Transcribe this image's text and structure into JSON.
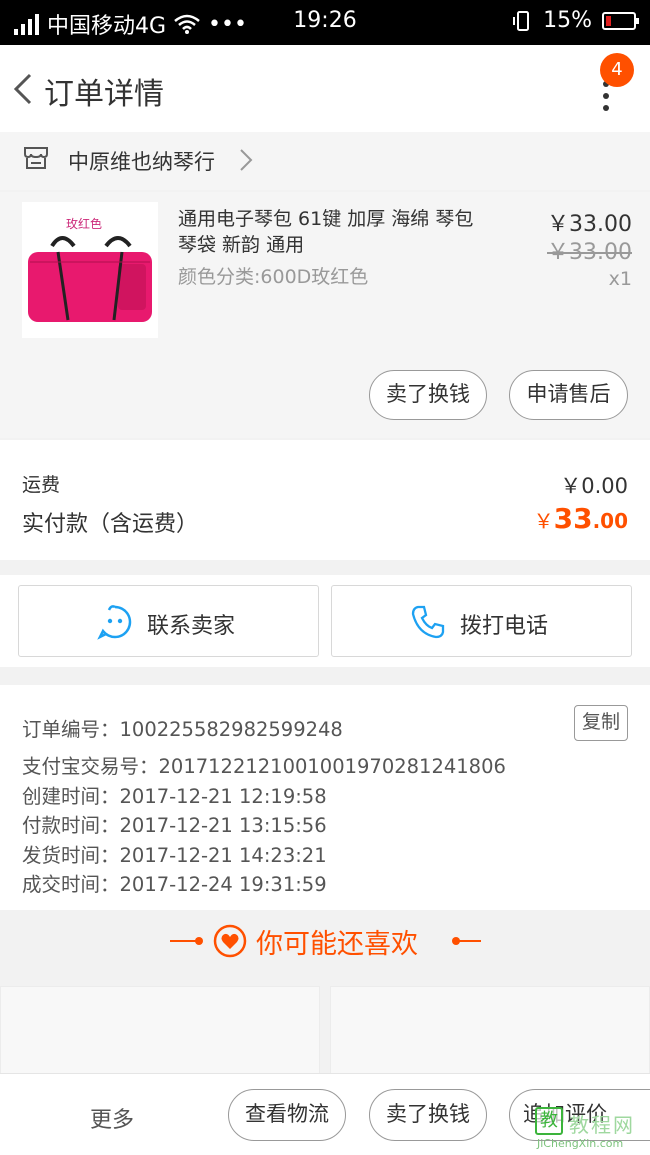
{
  "status_bar": {
    "carrier": "中国移动4G",
    "dots": "•••",
    "time": "19:26",
    "battery": "15%"
  },
  "header": {
    "title": "订单详情",
    "badge_count": "4"
  },
  "shop": {
    "name": "中原维也纳琴行"
  },
  "product": {
    "title": "通用电子琴包 61键 加厚 海绵 琴包 琴袋 新韵 通用",
    "sku": "颜色分类:600D玫红色",
    "price": "￥33.00",
    "original_price": "￥33.00",
    "quantity": "x1",
    "image_logo": "玫红色",
    "bag_color": "#e8196e",
    "buttons": [
      "卖了换钱",
      "申请售后"
    ]
  },
  "fees": {
    "freight_label": "运费",
    "freight_value": "￥0.00",
    "paid_label": "实付款（含运费）",
    "paid_currency": "￥",
    "paid_integer": "33",
    "paid_decimal": ".00"
  },
  "contact": {
    "seller_label": "联系卖家",
    "phone_label": "拨打电话"
  },
  "order_info": {
    "copy_label": "复制",
    "lines": [
      "订单编号：100225582982599248",
      "支付宝交易号：2017122121001001970281241806",
      "创建时间：2017-12-21 12:19:58",
      "付款时间：2017-12-21 13:15:56",
      "发货时间：2017-12-21 14:23:21",
      "成交时间：2017-12-24 19:31:59"
    ]
  },
  "recommend": {
    "title": "你可能还喜欢"
  },
  "bottom_bar": {
    "more": "更多",
    "logistics": "查看物流",
    "sell": "卖了换钱",
    "review": "追加评价"
  },
  "watermark": {
    "text": "教程网",
    "url": "JiChengXin.com"
  },
  "colors": {
    "accent": "#ff5000",
    "contact_icon": "#1da1f2"
  }
}
